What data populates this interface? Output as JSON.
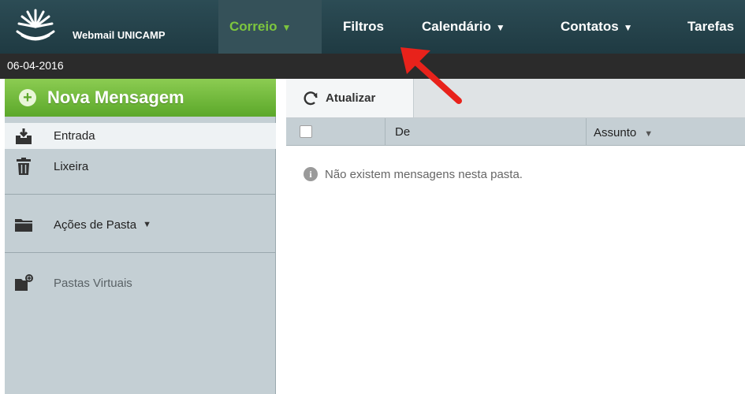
{
  "app": {
    "brand": "Webmail UNICAMP"
  },
  "nav": {
    "items": [
      {
        "label": "Correio",
        "active": true,
        "caret": true
      },
      {
        "label": "Filtros",
        "active": false,
        "caret": false
      },
      {
        "label": "Calendário",
        "active": false,
        "caret": true
      },
      {
        "label": "Contatos",
        "active": false,
        "caret": true
      },
      {
        "label": "Tarefas",
        "active": false,
        "caret": false
      }
    ],
    "active_color": "#7dc63e"
  },
  "date": "06-04-2016",
  "sidebar": {
    "new_message": "Nova Mensagem",
    "folders": [
      {
        "label": "Entrada",
        "icon": "inbox-icon",
        "selected": true
      },
      {
        "label": "Lixeira",
        "icon": "trash-icon",
        "selected": false
      }
    ],
    "folder_actions": "Ações de Pasta",
    "virtual_folders": "Pastas Virtuais"
  },
  "toolbar": {
    "refresh_label": "Atualizar"
  },
  "columns": {
    "from": "De",
    "subject": "Assunto"
  },
  "empty_message": "Não existem mensagens nesta pasta.",
  "colors": {
    "topbar": "#2c4c55",
    "sidebar": "#c4cfd4",
    "new_message_green": "#6cb53a",
    "annotation_arrow": "#e8221b"
  }
}
